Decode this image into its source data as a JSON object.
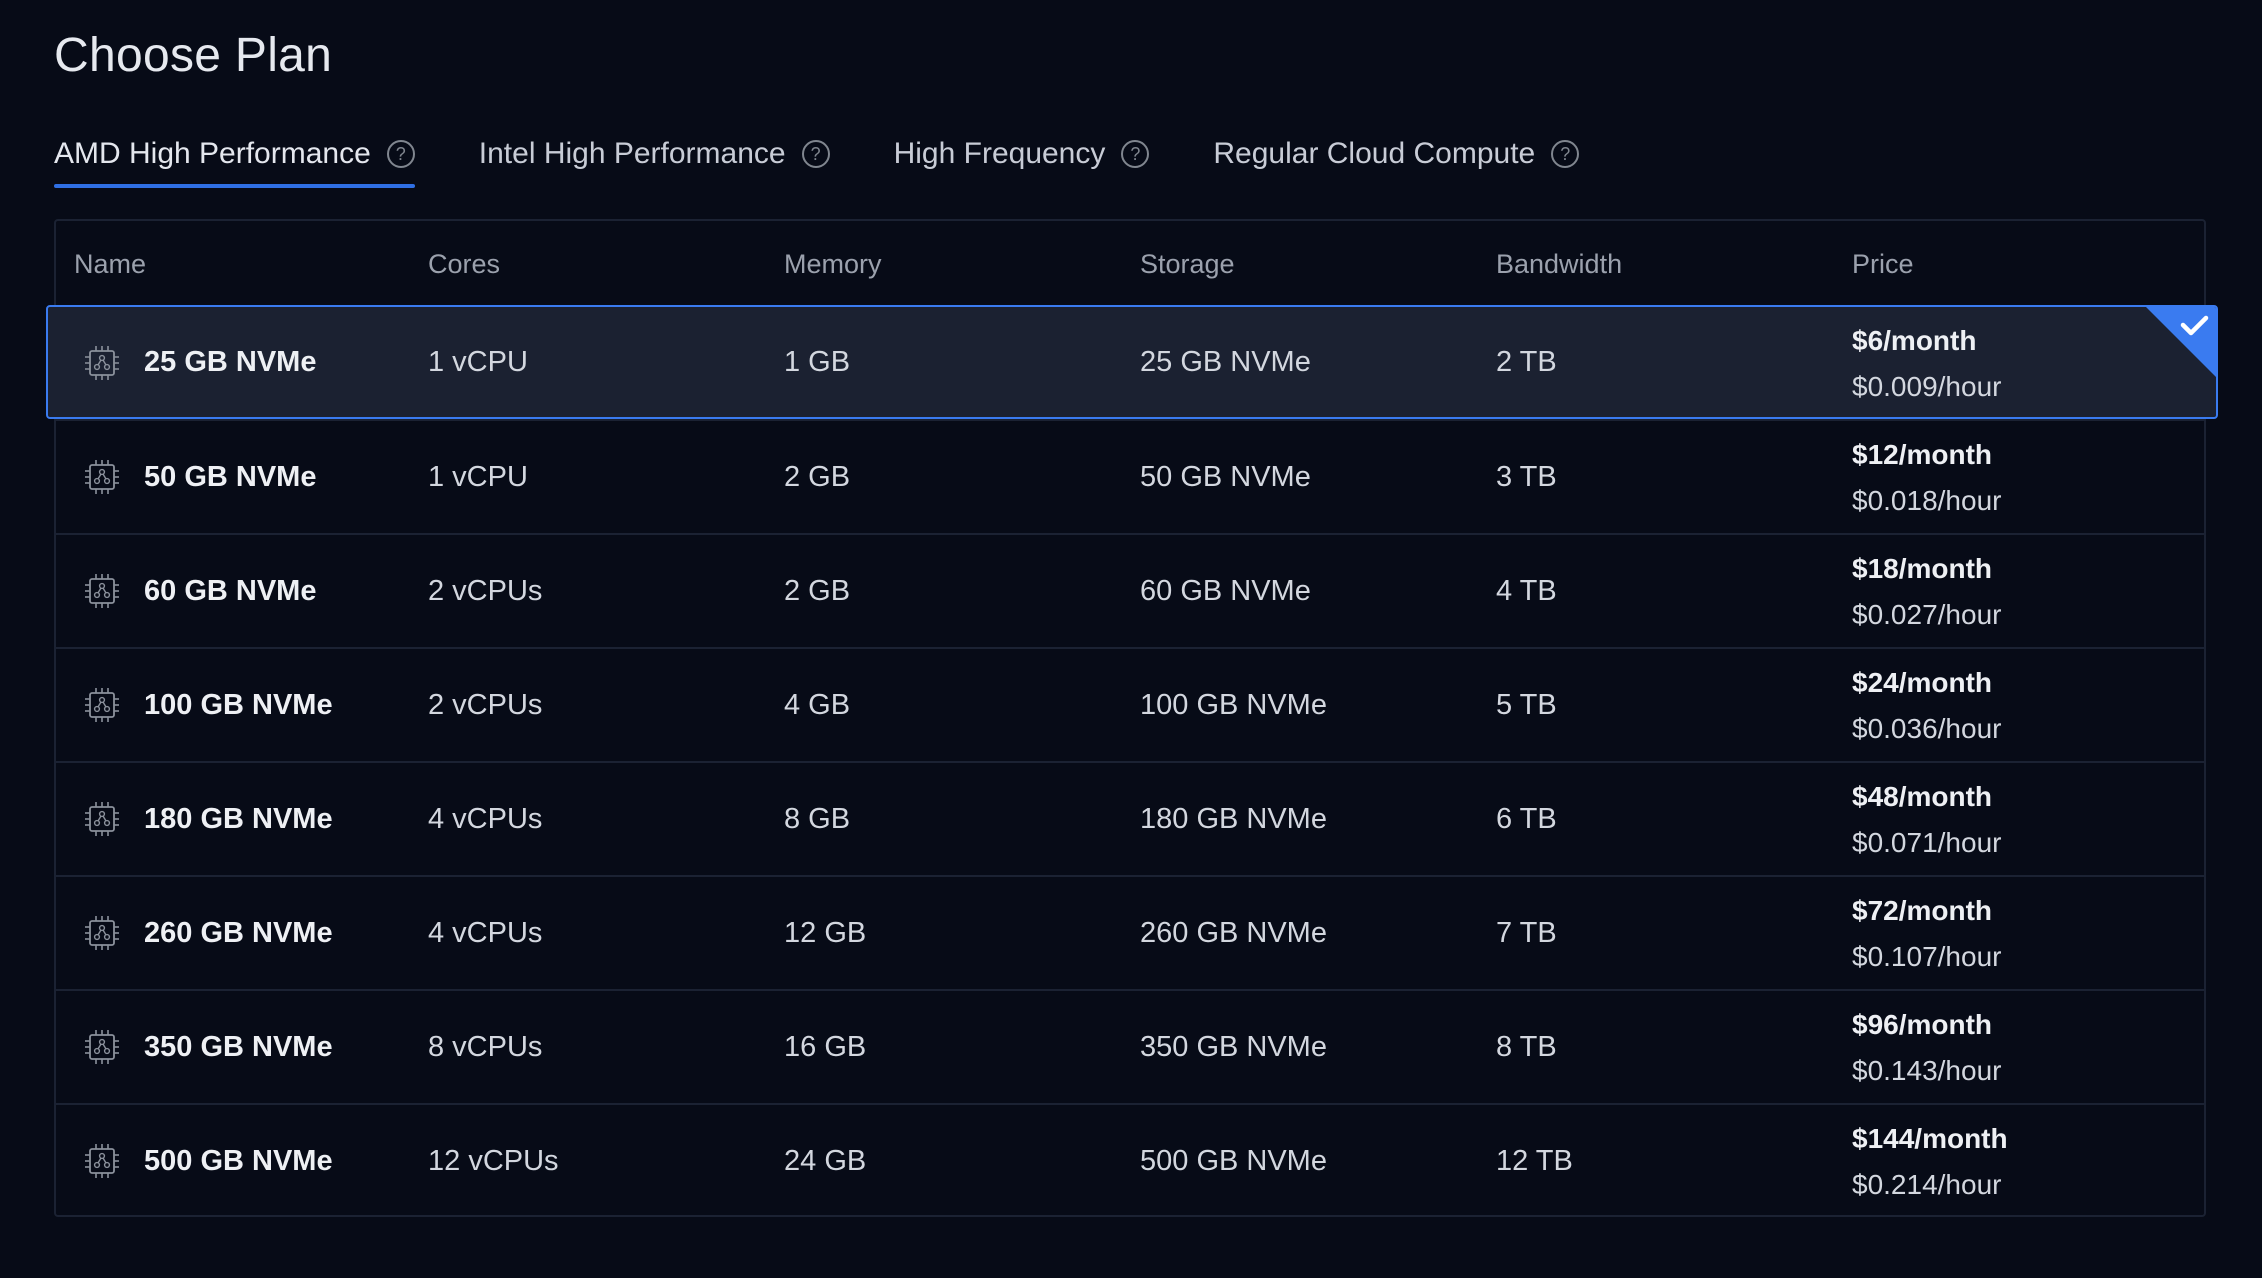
{
  "page": {
    "title": "Choose Plan"
  },
  "tabs": [
    {
      "label": "AMD High Performance",
      "active": true,
      "help_icon": "question-circle-icon"
    },
    {
      "label": "Intel High Performance",
      "active": false,
      "help_icon": "question-circle-icon"
    },
    {
      "label": "High Frequency",
      "active": false,
      "help_icon": "question-circle-icon"
    },
    {
      "label": "Regular Cloud Compute",
      "active": false,
      "help_icon": "question-circle-icon"
    }
  ],
  "table": {
    "headers": {
      "name": "Name",
      "cores": "Cores",
      "memory": "Memory",
      "storage": "Storage",
      "bandwidth": "Bandwidth",
      "price": "Price"
    },
    "rows": [
      {
        "name": "25 GB NVMe",
        "cores": "1 vCPU",
        "memory": "1 GB",
        "storage": "25 GB NVMe",
        "bandwidth": "2 TB",
        "price_month": "$6/month",
        "price_hour": "$0.009/hour",
        "selected": true
      },
      {
        "name": "50 GB NVMe",
        "cores": "1 vCPU",
        "memory": "2 GB",
        "storage": "50 GB NVMe",
        "bandwidth": "3 TB",
        "price_month": "$12/month",
        "price_hour": "$0.018/hour",
        "selected": false
      },
      {
        "name": "60 GB NVMe",
        "cores": "2 vCPUs",
        "memory": "2 GB",
        "storage": "60 GB NVMe",
        "bandwidth": "4 TB",
        "price_month": "$18/month",
        "price_hour": "$0.027/hour",
        "selected": false
      },
      {
        "name": "100 GB NVMe",
        "cores": "2 vCPUs",
        "memory": "4 GB",
        "storage": "100 GB NVMe",
        "bandwidth": "5 TB",
        "price_month": "$24/month",
        "price_hour": "$0.036/hour",
        "selected": false
      },
      {
        "name": "180 GB NVMe",
        "cores": "4 vCPUs",
        "memory": "8 GB",
        "storage": "180 GB NVMe",
        "bandwidth": "6 TB",
        "price_month": "$48/month",
        "price_hour": "$0.071/hour",
        "selected": false
      },
      {
        "name": "260 GB NVMe",
        "cores": "4 vCPUs",
        "memory": "12 GB",
        "storage": "260 GB NVMe",
        "bandwidth": "7 TB",
        "price_month": "$72/month",
        "price_hour": "$0.107/hour",
        "selected": false
      },
      {
        "name": "350 GB NVMe",
        "cores": "8 vCPUs",
        "memory": "16 GB",
        "storage": "350 GB NVMe",
        "bandwidth": "8 TB",
        "price_month": "$96/month",
        "price_hour": "$0.143/hour",
        "selected": false
      },
      {
        "name": "500 GB NVMe",
        "cores": "12 vCPUs",
        "memory": "24 GB",
        "storage": "500 GB NVMe",
        "bandwidth": "12 TB",
        "price_month": "$144/month",
        "price_hour": "$0.214/hour",
        "selected": false
      }
    ]
  },
  "icons": {
    "plan_row_icon": "cpu-chip-icon",
    "selected_marker": "checkmark-corner-icon"
  },
  "colors": {
    "accent": "#2f6fe4",
    "selected_border": "#3a7bf0",
    "selected_bg": "#1b2131",
    "background": "#070b17"
  }
}
